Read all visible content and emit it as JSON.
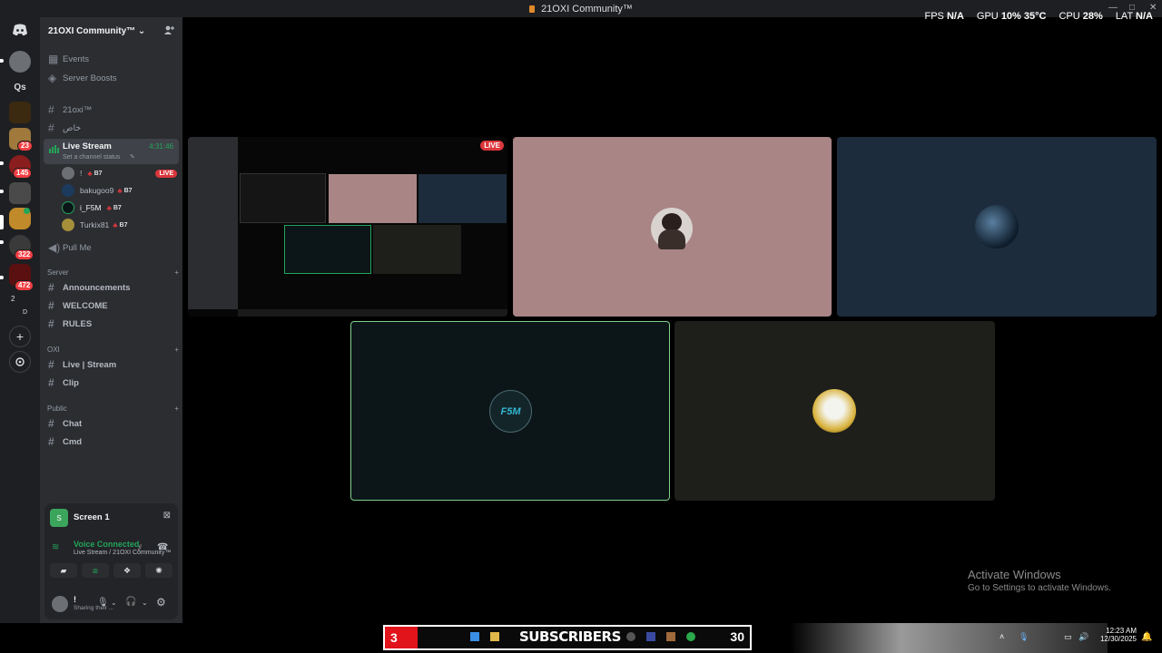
{
  "window": {
    "title": "21OXI Community™",
    "minimize": "—",
    "maximize": "□",
    "close": "✕"
  },
  "perf": {
    "fps_label": "FPS",
    "fps_value": "N/A",
    "gpu_label": "GPU",
    "gpu_value": "10%",
    "gpu_temp": "35°C",
    "cpu_label": "CPU",
    "cpu_value": "28%",
    "lat_label": "LAT",
    "lat_value": "N/A"
  },
  "rail": {
    "badges": [
      "23",
      "145",
      "322",
      "472"
    ],
    "small_top": "2",
    "small_bottom": "D",
    "qs": "Qs"
  },
  "guild": {
    "name": "21OXI Community™",
    "chevron": "⌄",
    "invite_icon": "person-add-icon"
  },
  "sidebar": {
    "events": "Events",
    "boosts": "Server Boosts",
    "channel_21oxi": "21oxi™",
    "channel_private": "خاص",
    "live_stream": {
      "name": "Live Stream",
      "timer": "4:31:46",
      "status": "Set a channel status"
    },
    "participants": [
      {
        "name": "!",
        "tag": "B7",
        "live": "LIVE"
      },
      {
        "name": "bakugoo9",
        "tag": "B7"
      },
      {
        "name": "i_F5M",
        "tag": "B7"
      },
      {
        "name": "Turkix81",
        "tag": "B7"
      }
    ],
    "pull_me": "Pull Me",
    "cat_server": "Server",
    "ch_announcements": "Announcements",
    "ch_welcome": "WELCOME",
    "ch_rules": "RULES",
    "cat_oxi": "OXI",
    "ch_live_stream": "Live | Stream",
    "ch_clip": "Clip",
    "cat_public": "Public",
    "ch_chat": "Chat",
    "ch_cmd": "Cmd"
  },
  "panel": {
    "screen_name": "Screen 1",
    "voice_connected": "Voice Connected",
    "voice_location": "Live Stream / 21OXI Community™",
    "user_name": "!",
    "user_status": "Sharing their ..."
  },
  "stage": {
    "live_badge": "LIVE",
    "f5m_text": "F5M"
  },
  "watermark": {
    "line1": "Activate Windows",
    "line2": "Go to Settings to activate Windows."
  },
  "taskbar": {
    "sub_left": "3",
    "sub_label": "SUBSCRIBERS",
    "sub_right": "30",
    "time": "12:23 AM",
    "date": "12/30/2025"
  },
  "colors": {
    "accent_green": "#23a55a",
    "live_red": "#da373c",
    "tile_pink": "#a98586",
    "tile_blue": "#1c2c3c",
    "tile_dark": "#0c1518",
    "tile_olive": "#1e1e1b"
  }
}
